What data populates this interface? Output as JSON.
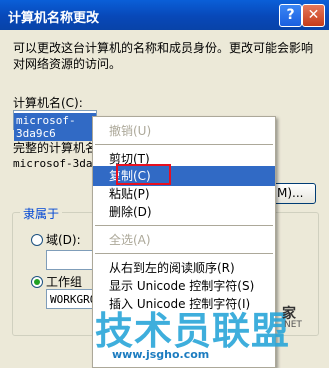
{
  "window": {
    "title": "计算机名称更改",
    "help_glyph": "?",
    "close_glyph": "✕"
  },
  "description": "可以更改这台计算机的名称和成员身份。更改可能会影响对网络资源的访问。",
  "computer_name": {
    "label": "计算机名(C):",
    "value": "microsof-3da9c6"
  },
  "full_name": {
    "label": "完整的计算机名称:",
    "value": "microsof-3da9"
  },
  "more_button": {
    "label": "M)..."
  },
  "member_of": {
    "title": "隶属于",
    "domain_label": "域(D):",
    "workgroup_label": "工作组",
    "workgroup_value": "WORKGRO"
  },
  "context_menu": {
    "items": [
      {
        "label": "撤销(U)",
        "state": "disabled"
      },
      {
        "label": "剪切(T)",
        "state": "normal"
      },
      {
        "label": "复制(C)",
        "state": "highlighted"
      },
      {
        "label": "粘贴(P)",
        "state": "normal"
      },
      {
        "label": "删除(D)",
        "state": "normal"
      },
      {
        "label": "全选(A)",
        "state": "disabled"
      },
      {
        "label": "从右到左的阅读顺序(R)",
        "state": "normal"
      },
      {
        "label": "显示 Unicode 控制字符(S)",
        "state": "normal"
      },
      {
        "label": "插入 Unicode 控制字符(I)",
        "state": "normal"
      }
    ]
  },
  "watermark": {
    "text": "技术员联盟",
    "url": "www.jsgho.com",
    "side": "家",
    "side_en": "NET"
  },
  "colors": {
    "titlebar": "#0A5FD8",
    "highlight": "#316AC5",
    "red_outline": "#E81020",
    "watermark": "#2AA6D9"
  }
}
